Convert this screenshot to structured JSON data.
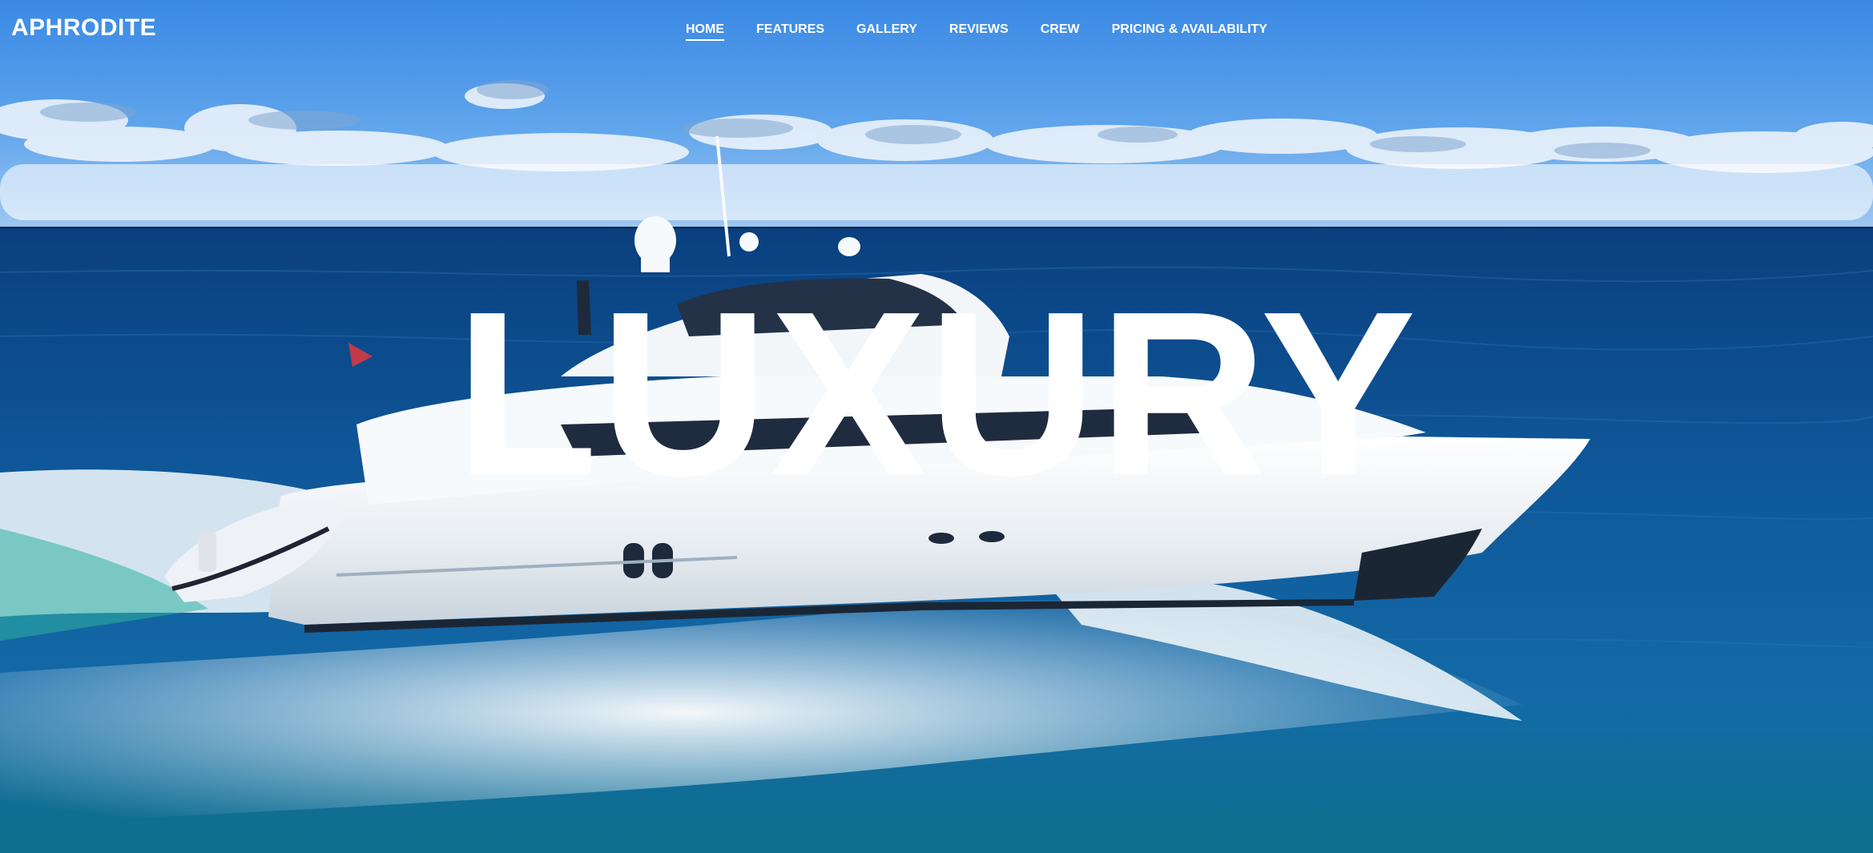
{
  "brand": {
    "name": "APHRODITE"
  },
  "nav": {
    "items": [
      {
        "label": "HOME",
        "active": true
      },
      {
        "label": "FEATURES",
        "active": false
      },
      {
        "label": "GALLERY",
        "active": false
      },
      {
        "label": "REVIEWS",
        "active": false
      },
      {
        "label": "CREW",
        "active": false
      },
      {
        "label": "PRICING & AVAILABILITY",
        "active": false
      }
    ]
  },
  "hero": {
    "headline": "LUXURY",
    "image": "yacht-at-sea-photo"
  },
  "colors": {
    "sky_top": "#3d8de6",
    "sky_horizon": "#8cc0f0",
    "sea_deep": "#0b4f8f",
    "sea_mid": "#1565a8",
    "text": "#ffffff",
    "yacht_hull": "#e8eef3",
    "wake": "#f4f9fc"
  }
}
